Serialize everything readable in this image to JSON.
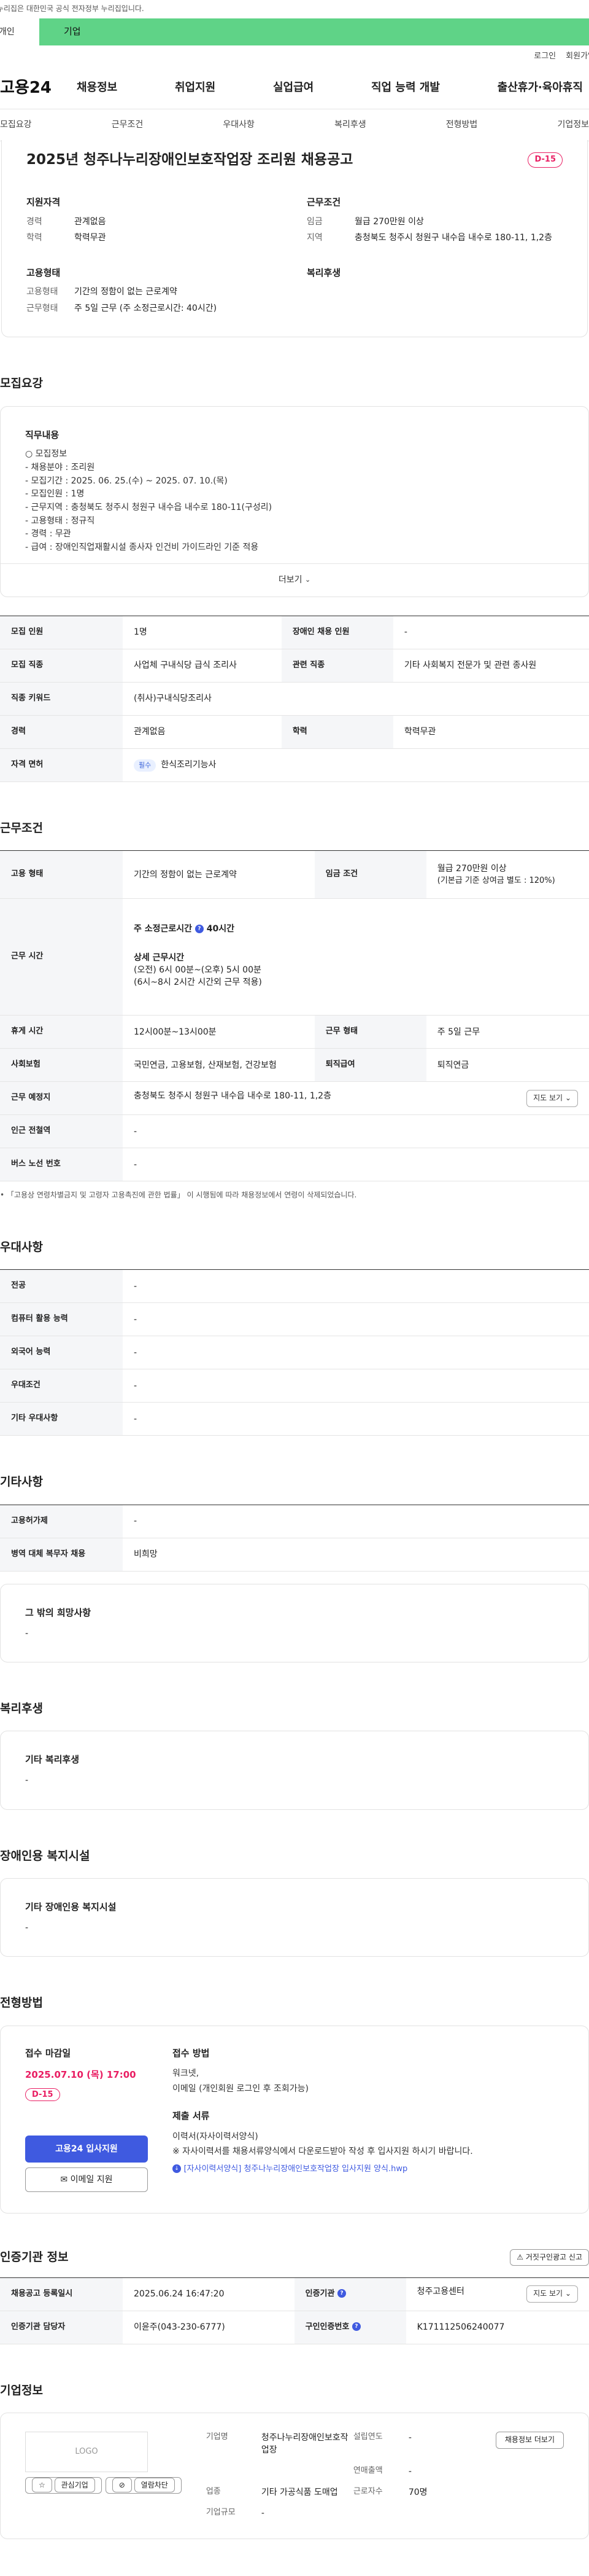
{
  "gov_notice": "이 누리집은 대한민국 공식 전자정부 누리집입니다.",
  "top_tabs": [
    "개인",
    "기업"
  ],
  "util_links": [
    "로그인",
    "회원가입"
  ],
  "logo": "고용24",
  "gnb": [
    "채용정보",
    "취업지원",
    "실업급여",
    "직업 능력 개발",
    "출산휴가·육아휴직"
  ],
  "subnav": [
    "모집요강",
    "근무조건",
    "우대사항",
    "복리후생",
    "전형방법",
    "기업정보"
  ],
  "job": {
    "title": "2025년 청주나누리장애인보호작업장 조리원 채용공고",
    "dday": "D-15",
    "qual_title": "지원자격",
    "career_k": "경력",
    "career_v": "관계없음",
    "edu_k": "학력",
    "edu_v": "학력무관",
    "cond_title": "근무조건",
    "wage_k": "임금",
    "wage_v": "월급 270만원 이상",
    "area_k": "지역",
    "area_v": "충청북도 청주시 청원구 내수읍 내수로 180-11, 1,2층",
    "emp_title": "고용형태",
    "emptype_k": "고용형태",
    "emptype_v": "기간의 정함이 없는 근로계약",
    "worktype_k": "근무형태",
    "worktype_v": "주 5일 근무 (주 소정근로시간: 40시간)",
    "welfare_title": "복리후생"
  },
  "recruit": {
    "title": "모집요강",
    "duty_title": "직무내용",
    "duty_lines": [
      "○ 모집정보",
      "- 채용분야 : 조리원",
      "- 모집기간 : 2025. 06. 25.(수) ~ 2025. 07. 10.(목)",
      "- 모집인원 : 1명",
      "- 근무지역 : 충청북도 청주시 청원구 내수읍 내수로 180-11(구성리)",
      "- 고용형태 : 정규직",
      "- 경력 : 무관",
      "- 급여 : 장애인직업재활시설 종사자 인건비 가이드라인 기준 적용"
    ],
    "more": "더보기",
    "rows": [
      [
        "모집 인원",
        "1명",
        "장애인 채용 인원",
        "-"
      ],
      [
        "모집 직종",
        "사업체 구내식당 급식 조리사",
        "관련 직종",
        "기타 사회복지 전문가 및 관련 종사원"
      ],
      [
        "직종 키워드",
        "(취사)구내식당조리사",
        "",
        ""
      ],
      [
        "경력",
        "관계없음",
        "학력",
        "학력무관"
      ]
    ],
    "license_k": "자격 면허",
    "license_badge": "필수",
    "license_v": "한식조리기능사"
  },
  "work": {
    "title": "근무조건",
    "emp_k": "고용 형태",
    "emp_v": "기간의 정함이 없는 근로계약",
    "wage_k": "임금 조건",
    "wage_v1": "월급 270만원 이상",
    "wage_v2": "(기본급 기준 상여금 별도 : 120%)",
    "time_k": "근무 시간",
    "weekly": "주 소정근로시간",
    "weekly_v": "40시간",
    "detail_title": "상세 근무시간",
    "detail_1": "(오전) 6시 00분~(오후) 5시 00분",
    "detail_2": "(6시~8시 2시간 시간외 근무 적용)",
    "rest_k": "휴게 시간",
    "rest_v": "12시00분~13시00분",
    "form_k": "근무 형태",
    "form_v": "주 5일 근무",
    "ins_k": "사회보험",
    "ins_v": "국민연금, 고용보험, 산재보험, 건강보험",
    "retire_k": "퇴직급여",
    "retire_v": "퇴직연금",
    "place_k": "근무 예정지",
    "place_v": "충청북도 청주시 청원구 내수읍 내수로 180-11, 1,2층",
    "map_btn": "지도 보기",
    "station_k": "인근 전철역",
    "station_v": "-",
    "bus_k": "버스 노선 번호",
    "bus_v": "-",
    "note": "「고용상 연령차별금지 및 고령자 고용촉진에 관한 법률」 이 시행됨에 따라 채용정보에서 연령이 삭제되었습니다."
  },
  "prefer": {
    "title": "우대사항",
    "rows": [
      [
        "전공",
        "-"
      ],
      [
        "컴퓨터 활용 능력",
        "-"
      ],
      [
        "외국어 능력",
        "-"
      ],
      [
        "우대조건",
        "-"
      ],
      [
        "기타 우대사항",
        "-"
      ]
    ]
  },
  "etc": {
    "title": "기타사항",
    "rows": [
      [
        "고용허가제",
        "-"
      ],
      [
        "병역 대체 복무자 채용",
        "비희망"
      ]
    ],
    "other_hope": "그 밖의 희망사항",
    "other_hope_v": "-"
  },
  "welfare": {
    "title": "복리후생",
    "box_title": "기타 복리후생",
    "box_v": "-"
  },
  "disabled": {
    "title": "장애인용 복지시설",
    "box_title": "기타 장애인용 복지시설",
    "box_v": "-"
  },
  "process": {
    "title": "전형방법",
    "deadline_label": "접수 마감일",
    "deadline": "2025.07.10 (목) 17:00",
    "dday": "D-15",
    "apply_btn": "고용24 입사지원",
    "email_btn": "이메일 지원",
    "method_title": "접수 방법",
    "method_1": "워크넷,",
    "method_2": "이메일 (개인회원 로그인 후 조회가능)",
    "docs_title": "제출 서류",
    "docs_1": "이력서(자사이력서양식)",
    "docs_2": "※ 자사이력서를 채용서류양식에서 다운로드받아 작성 후 입사지원 하시기 바랍니다.",
    "file": "[자사이력서양식] 청주나누리장애인보호작업장 입사지원 양식.hwp"
  },
  "cert": {
    "title": "인증기관 정보",
    "report_btn": "거짓구인광고 신고",
    "reg_k": "채용공고 등록일시",
    "reg_v": "2025.06.24 16:47:20",
    "org_k": "인증기관",
    "org_v": "청주고용센터",
    "map_btn": "지도 보기",
    "mgr_k": "인증기관 담당자",
    "mgr_v": "이윤주(043-230-6777)",
    "no_k": "구인인증번호",
    "no_v": "K171112506240077"
  },
  "company": {
    "title": "기업정보",
    "logo": "LOGO",
    "fav": "관심기업",
    "block": "열람차단",
    "name_k": "기업명",
    "name_v": "청주나누리장애인보호작업장",
    "found_k": "설립연도",
    "found_v": "-",
    "sales_k": "연매출액",
    "sales_v": "-",
    "ind_k": "업종",
    "ind_v": "기타 가공식품 도매업",
    "emp_k": "근로자수",
    "emp_v": "70명",
    "size_k": "기업규모",
    "size_v": "-",
    "info_btn": "채용정보 더보기"
  }
}
